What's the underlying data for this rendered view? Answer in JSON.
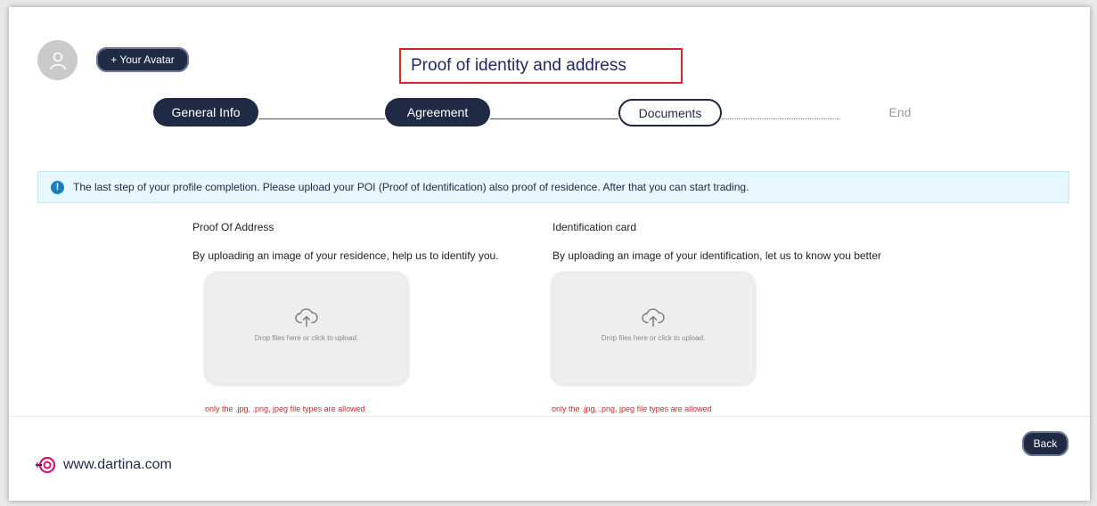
{
  "header": {
    "avatar_button": "+ Your Avatar",
    "page_title": "Proof of identity and address"
  },
  "stepper": {
    "steps": [
      {
        "label": "General Info",
        "state": "done"
      },
      {
        "label": "Agreement",
        "state": "done"
      },
      {
        "label": "Documents",
        "state": "current"
      },
      {
        "label": "End",
        "state": "future"
      }
    ]
  },
  "alert": {
    "icon": "info-icon",
    "glyph": "!",
    "text": "The last step of your profile completion. Please upload your POI (Proof of Identification) also proof of residence. After that you can start trading."
  },
  "uploads": [
    {
      "title": "Proof Of Address",
      "description": "By uploading an image of your residence, help us to identify you.",
      "drop_text": "Drop files here or click to upload.",
      "error": "only the .jpg, .png, jpeg file types are allowed"
    },
    {
      "title": "Identification card",
      "description": "By uploading an image of your identification, let us to know you better",
      "drop_text": "Drop files here or click to upload.",
      "error": "only the .jpg, .png, jpeg file types are allowed"
    }
  ],
  "footer": {
    "back_button": "Back",
    "brand": "www.dartina.com"
  },
  "colors": {
    "primary": "#1f2a44",
    "error": "#e0231f",
    "info_bg": "#e6f7fd",
    "info_icon": "#1a7ec2",
    "brand_accent": "#d6127a"
  }
}
